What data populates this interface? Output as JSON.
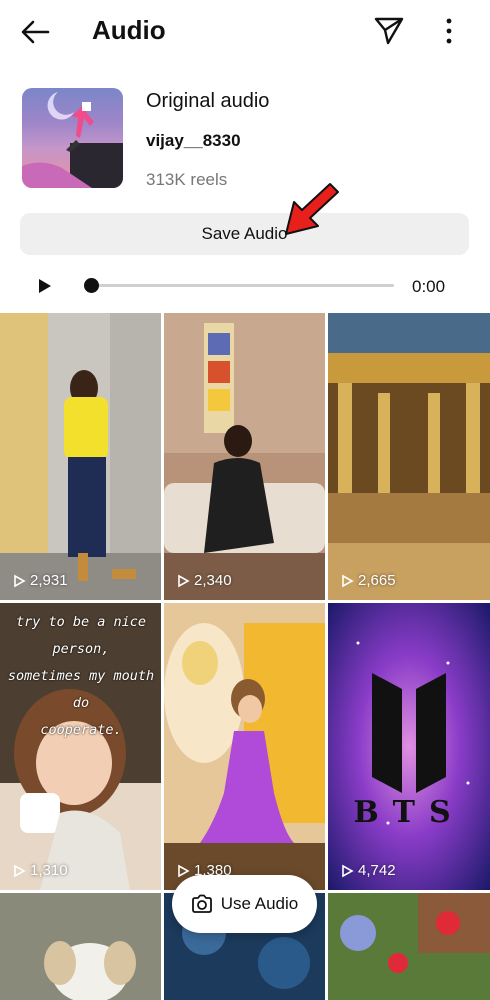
{
  "header": {
    "title": "Audio",
    "back_icon": "arrow-left-icon",
    "share_icon": "paper-plane-icon",
    "more_icon": "more-vertical-icon"
  },
  "audio": {
    "name": "Original audio",
    "author": "vijay__8330",
    "reels": "313K reels",
    "save_label": "Save Audio"
  },
  "player": {
    "time": "0:00",
    "progress": 0
  },
  "reels": [
    {
      "views": "2,931"
    },
    {
      "views": "2,340"
    },
    {
      "views": "2,665"
    },
    {
      "views": "1,310",
      "caption": "try to be a nice person,\nsometimes my mouth do\ncooperate."
    },
    {
      "views": "1,380"
    },
    {
      "views": "4,742",
      "logo_text": "BTS"
    },
    {},
    {},
    {}
  ],
  "use_audio": {
    "label": "Use Audio",
    "icon": "camera-icon"
  },
  "annotation": {
    "icon": "red-arrow-icon",
    "color": "#e8201c"
  }
}
